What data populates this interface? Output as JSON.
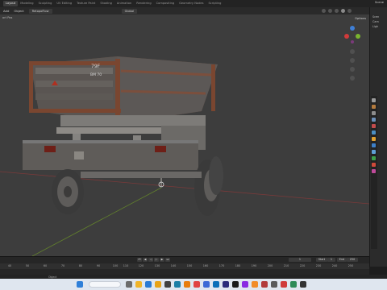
{
  "workspace_tabs": [
    "Layout",
    "Modeling",
    "Sculpting",
    "UV Editing",
    "Texture Paint",
    "Shading",
    "Animation",
    "Rendering",
    "Compositing",
    "Geometry Nodes",
    "Scripting"
  ],
  "scene_label": "Scene",
  "header": {
    "items": [
      "Add",
      "Object"
    ],
    "retopoflow": "RetopoFlow",
    "global": "Global",
    "viewport_label": "ort Pos"
  },
  "viewport": {
    "options_label": "Options",
    "crate_text_1": "79F",
    "crate_text_2": "BM 70"
  },
  "timeline": {
    "start_label": "Start",
    "start_value": "1",
    "end_label": "End",
    "end_value": "250",
    "current_frame": "1",
    "ticks": [
      "0",
      "10",
      "20",
      "30",
      "40",
      "50",
      "60",
      "70",
      "80",
      "90",
      "100",
      "110",
      "120",
      "130",
      "140",
      "150",
      "160",
      "170",
      "180",
      "190",
      "200",
      "210",
      "220",
      "230",
      "240",
      "250"
    ]
  },
  "status": {
    "items": [
      "Object"
    ]
  },
  "colors": {
    "accent": "#e87d0d",
    "playhead": "#3b6fd1",
    "grid_red": "#8c3a3a",
    "grid_green": "#5f7f2a"
  }
}
